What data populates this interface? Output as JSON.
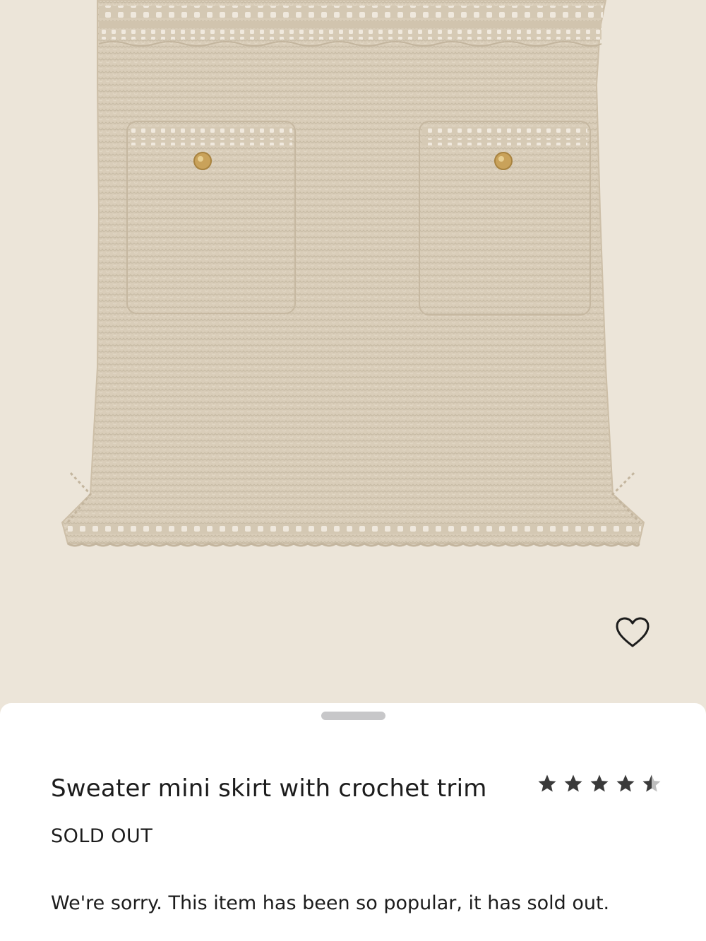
{
  "product": {
    "image_alt": "Beige crochet knit mini skirt with two patch pockets and gold buttons",
    "title": "Sweater mini skirt with crochet trim",
    "rating": 4.5,
    "rating_max": 5,
    "status": "SOLD OUT",
    "message": "We're sorry. This item has been so popular, it has sold out."
  },
  "icons": {
    "favorite": "heart-outline-icon",
    "star_full": "star-icon",
    "star_half": "star-half-icon"
  },
  "colors": {
    "background": "#ece5d9",
    "skirt": "#d9cdb9",
    "button_gold": "#c9a25a",
    "text": "#1c1c1c",
    "star": "#3a3a3a",
    "sheet": "#ffffff"
  }
}
